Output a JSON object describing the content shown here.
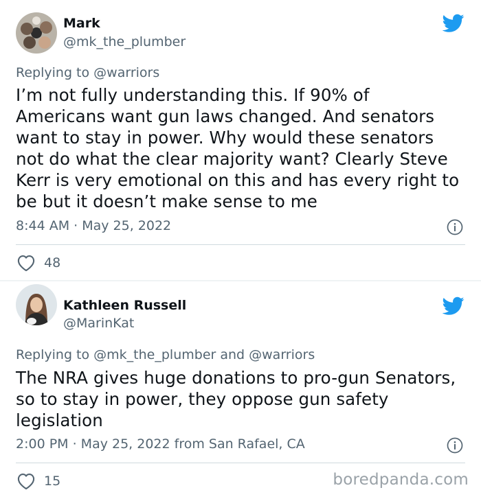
{
  "tweets": [
    {
      "author": {
        "name": "Mark",
        "handle": "@mk_the_plumber"
      },
      "reply": {
        "prefix": "Replying to",
        "mentions": "@warriors"
      },
      "text": "I’m not fully understanding this. If 90% of Americans want gun laws changed. And senators want to stay in power. Why would these senators not do what the clear majority want? Clearly Steve Kerr is very emotional on this and has every right to be but it doesn’t make sense to me",
      "meta": "8:44 AM · May 25, 2022",
      "likes": "48"
    },
    {
      "author": {
        "name": "Kathleen Russell",
        "handle": "@MarinKat"
      },
      "reply": {
        "prefix": "Replying to",
        "mentions": "@mk_the_plumber and @warriors"
      },
      "text": "The NRA gives huge donations to pro-gun Senators, so to stay in power, they oppose gun safety legislation",
      "meta": "2:00 PM · May 25, 2022 from San Rafael, CA",
      "likes": "15"
    }
  ],
  "watermark": "boredpanda.com",
  "colors": {
    "twitter_blue": "#1d9bf0",
    "secondary_text": "#536471",
    "primary_text": "#0f1419"
  }
}
